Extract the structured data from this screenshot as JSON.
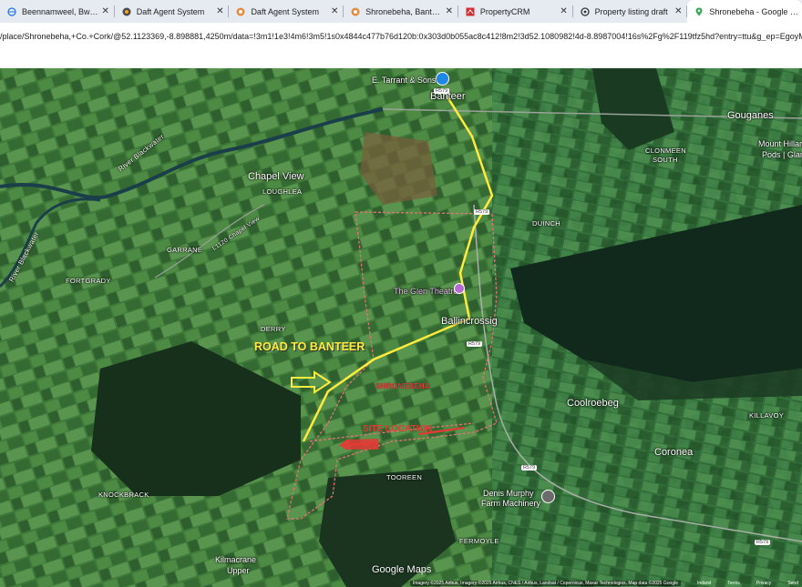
{
  "tabs": [
    {
      "title": "Beennamweel, Bweeng, Co",
      "icon": "globe-icon",
      "active": false
    },
    {
      "title": "Daft Agent System",
      "icon": "daft-icon",
      "active": false
    },
    {
      "title": "Daft Agent System",
      "icon": "daft-icon",
      "active": false
    },
    {
      "title": "Shronebeha, Banteer, Co.",
      "icon": "daft-icon",
      "active": false
    },
    {
      "title": "PropertyCRM",
      "icon": "crm-icon",
      "active": false
    },
    {
      "title": "Property listing draft",
      "icon": "openai-icon",
      "active": false
    },
    {
      "title": "Shronebeha - Google Ma",
      "icon": "maps-pin-icon",
      "active": true
    }
  ],
  "url": "/place/Shronebeha,+Co.+Cork/@52.1123369,-8.898881,4250m/data=!3m1!1e3!4m6!3m5!1s0x4844c477b76d120b:0x303d0b055ac8c412!8m2!3d52.1080982!4d-8.8987004!16s%2Fg%2F119tfz5hd?entry=ttu&g_ep=EgoyMDI1MD...",
  "map": {
    "places": {
      "tarrant": "E. Tarrant & Sons",
      "banteer": "Banteer",
      "gouganes": "Gouganes",
      "mount_hillary": "Mount Hillar",
      "mount_hillary2": "Pods | Glam",
      "clonmeen": "CLONMEEN",
      "clonmeen2": "SOUTH",
      "chapel_view": "Chapel View",
      "loughlea": "LOUGHLEA",
      "duinch": "DUINCH",
      "garrane": "GARRANE",
      "fortgrady": "FORTGRADY",
      "glen_theatre": "The Glen Theatre",
      "ballincrossig": "Ballincrossig",
      "derry": "DERRY",
      "shronebeha": "SHRONEBEHA",
      "coolroebeg": "Coolroebeg",
      "killavoy": "KILLAVOY",
      "coronea": "Coronea",
      "knockbrack": "KNOCKBRACK",
      "tooreen": "TOOREEN",
      "denis_murphy": "Denis Murphy",
      "denis_murphy2": "Farm Machinery",
      "fermoyle": "FERMOYLE",
      "kilmacrane": "Kilmacrane",
      "kilmacrane2": "Upper",
      "river": "River Blackwater",
      "river2": "River Blackwater",
      "chapel_view_road": "L1120 Chapel View"
    },
    "annotations": {
      "road_to_banteer": "ROAD TO BANTEER",
      "site_location": "SITE LOCATION"
    },
    "shields": {
      "r579a": "R579",
      "r579b": "R579",
      "r579c": "R579",
      "r579d": "R579",
      "r579e": "R579"
    },
    "logo": "Google Maps",
    "attribution": {
      "imagery": "Imagery ©2025 Airbus, Imagery ©2025 Airbus, CNES / Airbus, Landsat / Copernicus, Maxar Technologies, Map data ©2025 Google",
      "country": "Ireland",
      "terms": "Terms",
      "privacy": "Privacy",
      "send": "Send"
    },
    "colors": {
      "route": "#ffeb3b",
      "boundary": "#e57373",
      "site_arrow": "#e53935"
    }
  }
}
